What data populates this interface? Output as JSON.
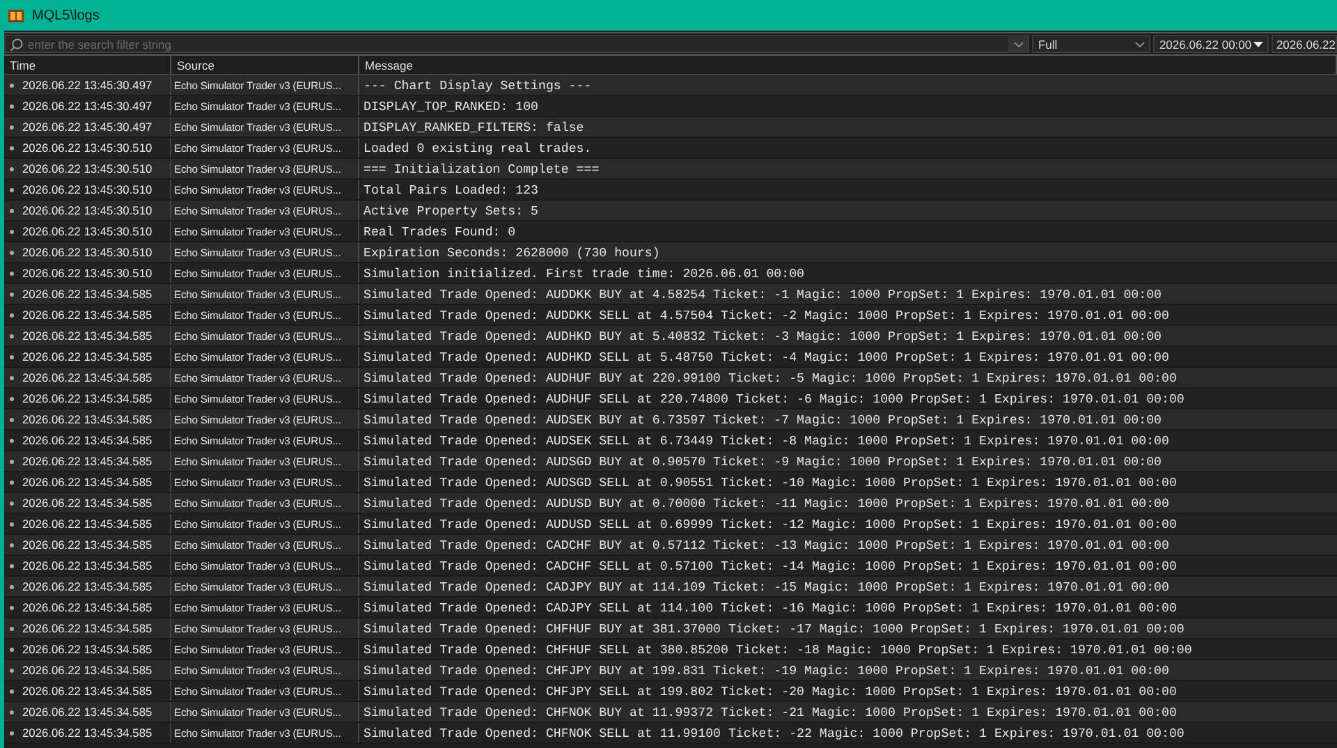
{
  "window": {
    "title": "MQL5\\logs"
  },
  "toolbar": {
    "search": {
      "placeholder": "enter the search filter string"
    },
    "mode": {
      "value": "Full"
    },
    "date_from": {
      "value": "2026.06.22 00:00"
    },
    "date_to": {
      "value": "2026.06.22"
    }
  },
  "table": {
    "columns": [
      "Time",
      "Source",
      "Message"
    ],
    "rows": [
      {
        "time": "2026.06.22 13:45:30.497",
        "source": "Echo Simulator Trader v3 (EURUS...",
        "message": "--- Chart Display Settings ---"
      },
      {
        "time": "2026.06.22 13:45:30.497",
        "source": "Echo Simulator Trader v3 (EURUS...",
        "message": "DISPLAY_TOP_RANKED: 100"
      },
      {
        "time": "2026.06.22 13:45:30.497",
        "source": "Echo Simulator Trader v3 (EURUS...",
        "message": "DISPLAY_RANKED_FILTERS: false"
      },
      {
        "time": "2026.06.22 13:45:30.510",
        "source": "Echo Simulator Trader v3 (EURUS...",
        "message": "Loaded 0 existing real trades."
      },
      {
        "time": "2026.06.22 13:45:30.510",
        "source": "Echo Simulator Trader v3 (EURUS...",
        "message": "=== Initialization Complete ==="
      },
      {
        "time": "2026.06.22 13:45:30.510",
        "source": "Echo Simulator Trader v3 (EURUS...",
        "message": "Total Pairs Loaded: 123"
      },
      {
        "time": "2026.06.22 13:45:30.510",
        "source": "Echo Simulator Trader v3 (EURUS...",
        "message": "Active Property Sets: 5"
      },
      {
        "time": "2026.06.22 13:45:30.510",
        "source": "Echo Simulator Trader v3 (EURUS...",
        "message": "Real Trades Found: 0"
      },
      {
        "time": "2026.06.22 13:45:30.510",
        "source": "Echo Simulator Trader v3 (EURUS...",
        "message": "Expiration Seconds: 2628000 (730 hours)"
      },
      {
        "time": "2026.06.22 13:45:30.510",
        "source": "Echo Simulator Trader v3 (EURUS...",
        "message": "Simulation initialized. First trade time: 2026.06.01 00:00"
      },
      {
        "time": "2026.06.22 13:45:34.585",
        "source": "Echo Simulator Trader v3 (EURUS...",
        "message": "Simulated Trade Opened: AUDDKK BUY at 4.58254 Ticket: -1 Magic: 1000 PropSet: 1 Expires: 1970.01.01 00:00"
      },
      {
        "time": "2026.06.22 13:45:34.585",
        "source": "Echo Simulator Trader v3 (EURUS...",
        "message": "Simulated Trade Opened: AUDDKK SELL at 4.57504 Ticket: -2 Magic: 1000 PropSet: 1 Expires: 1970.01.01 00:00"
      },
      {
        "time": "2026.06.22 13:45:34.585",
        "source": "Echo Simulator Trader v3 (EURUS...",
        "message": "Simulated Trade Opened: AUDHKD BUY at 5.40832 Ticket: -3 Magic: 1000 PropSet: 1 Expires: 1970.01.01 00:00"
      },
      {
        "time": "2026.06.22 13:45:34.585",
        "source": "Echo Simulator Trader v3 (EURUS...",
        "message": "Simulated Trade Opened: AUDHKD SELL at 5.48750 Ticket: -4 Magic: 1000 PropSet: 1 Expires: 1970.01.01 00:00"
      },
      {
        "time": "2026.06.22 13:45:34.585",
        "source": "Echo Simulator Trader v3 (EURUS...",
        "message": "Simulated Trade Opened: AUDHUF BUY at 220.99100 Ticket: -5 Magic: 1000 PropSet: 1 Expires: 1970.01.01 00:00"
      },
      {
        "time": "2026.06.22 13:45:34.585",
        "source": "Echo Simulator Trader v3 (EURUS...",
        "message": "Simulated Trade Opened: AUDHUF SELL at 220.74800 Ticket: -6 Magic: 1000 PropSet: 1 Expires: 1970.01.01 00:00"
      },
      {
        "time": "2026.06.22 13:45:34.585",
        "source": "Echo Simulator Trader v3 (EURUS...",
        "message": "Simulated Trade Opened: AUDSEK BUY at 6.73597 Ticket: -7 Magic: 1000 PropSet: 1 Expires: 1970.01.01 00:00"
      },
      {
        "time": "2026.06.22 13:45:34.585",
        "source": "Echo Simulator Trader v3 (EURUS...",
        "message": "Simulated Trade Opened: AUDSEK SELL at 6.73449 Ticket: -8 Magic: 1000 PropSet: 1 Expires: 1970.01.01 00:00"
      },
      {
        "time": "2026.06.22 13:45:34.585",
        "source": "Echo Simulator Trader v3 (EURUS...",
        "message": "Simulated Trade Opened: AUDSGD BUY at 0.90570 Ticket: -9 Magic: 1000 PropSet: 1 Expires: 1970.01.01 00:00"
      },
      {
        "time": "2026.06.22 13:45:34.585",
        "source": "Echo Simulator Trader v3 (EURUS...",
        "message": "Simulated Trade Opened: AUDSGD SELL at 0.90551 Ticket: -10 Magic: 1000 PropSet: 1 Expires: 1970.01.01 00:00"
      },
      {
        "time": "2026.06.22 13:45:34.585",
        "source": "Echo Simulator Trader v3 (EURUS...",
        "message": "Simulated Trade Opened: AUDUSD BUY at 0.70000 Ticket: -11 Magic: 1000 PropSet: 1 Expires: 1970.01.01 00:00"
      },
      {
        "time": "2026.06.22 13:45:34.585",
        "source": "Echo Simulator Trader v3 (EURUS...",
        "message": "Simulated Trade Opened: AUDUSD SELL at 0.69999 Ticket: -12 Magic: 1000 PropSet: 1 Expires: 1970.01.01 00:00"
      },
      {
        "time": "2026.06.22 13:45:34.585",
        "source": "Echo Simulator Trader v3 (EURUS...",
        "message": "Simulated Trade Opened: CADCHF BUY at 0.57112 Ticket: -13 Magic: 1000 PropSet: 1 Expires: 1970.01.01 00:00"
      },
      {
        "time": "2026.06.22 13:45:34.585",
        "source": "Echo Simulator Trader v3 (EURUS...",
        "message": "Simulated Trade Opened: CADCHF SELL at 0.57100 Ticket: -14 Magic: 1000 PropSet: 1 Expires: 1970.01.01 00:00"
      },
      {
        "time": "2026.06.22 13:45:34.585",
        "source": "Echo Simulator Trader v3 (EURUS...",
        "message": "Simulated Trade Opened: CADJPY BUY at 114.109 Ticket: -15 Magic: 1000 PropSet: 1 Expires: 1970.01.01 00:00"
      },
      {
        "time": "2026.06.22 13:45:34.585",
        "source": "Echo Simulator Trader v3 (EURUS...",
        "message": "Simulated Trade Opened: CADJPY SELL at 114.100 Ticket: -16 Magic: 1000 PropSet: 1 Expires: 1970.01.01 00:00"
      },
      {
        "time": "2026.06.22 13:45:34.585",
        "source": "Echo Simulator Trader v3 (EURUS...",
        "message": "Simulated Trade Opened: CHFHUF BUY at 381.37000 Ticket: -17 Magic: 1000 PropSet: 1 Expires: 1970.01.01 00:00"
      },
      {
        "time": "2026.06.22 13:45:34.585",
        "source": "Echo Simulator Trader v3 (EURUS...",
        "message": "Simulated Trade Opened: CHFHUF SELL at 380.85200 Ticket: -18 Magic: 1000 PropSet: 1 Expires: 1970.01.01 00:00"
      },
      {
        "time": "2026.06.22 13:45:34.585",
        "source": "Echo Simulator Trader v3 (EURUS...",
        "message": "Simulated Trade Opened: CHFJPY BUY at 199.831 Ticket: -19 Magic: 1000 PropSet: 1 Expires: 1970.01.01 00:00"
      },
      {
        "time": "2026.06.22 13:45:34.585",
        "source": "Echo Simulator Trader v3 (EURUS...",
        "message": "Simulated Trade Opened: CHFJPY SELL at 199.802 Ticket: -20 Magic: 1000 PropSet: 1 Expires: 1970.01.01 00:00"
      },
      {
        "time": "2026.06.22 13:45:34.585",
        "source": "Echo Simulator Trader v3 (EURUS...",
        "message": "Simulated Trade Opened: CHFNOK BUY at 11.99372 Ticket: -21 Magic: 1000 PropSet: 1 Expires: 1970.01.01 00:00"
      },
      {
        "time": "2026.06.22 13:45:34.585",
        "source": "Echo Simulator Trader v3 (EURUS...",
        "message": "Simulated Trade Opened: CHFNOK SELL at 11.99100 Ticket: -22 Magic: 1000 PropSet: 1 Expires: 1970.01.01 00:00"
      }
    ]
  }
}
